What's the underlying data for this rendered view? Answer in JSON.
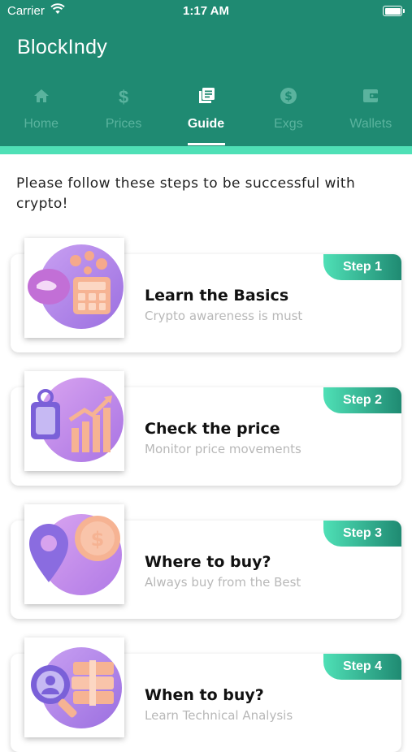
{
  "status_bar": {
    "carrier": "Carrier",
    "time": "1:17 AM"
  },
  "header": {
    "title": "BlockIndy"
  },
  "tabs": [
    {
      "label": "Home",
      "icon": "home-icon"
    },
    {
      "label": "Prices",
      "icon": "dollar-icon"
    },
    {
      "label": "Guide",
      "icon": "guide-book-icon",
      "active": true
    },
    {
      "label": "Exgs",
      "icon": "coin-icon"
    },
    {
      "label": "Wallets",
      "icon": "wallet-icon"
    }
  ],
  "intro": "Please follow these steps to be successful with crypto!",
  "steps": [
    {
      "badge": "Step 1",
      "title": "Learn the Basics",
      "subtitle": "Crypto awareness is must",
      "icon": "calculator-coins-icon"
    },
    {
      "badge": "Step 2",
      "title": "Check the price",
      "subtitle": "Monitor price movements",
      "icon": "price-tag-chart-icon"
    },
    {
      "badge": "Step 3",
      "title": "Where to buy?",
      "subtitle": "Always buy from the Best",
      "icon": "location-coin-icon"
    },
    {
      "badge": "Step 4",
      "title": "When to buy?",
      "subtitle": "Learn Technical Analysis",
      "icon": "magnifier-money-icon"
    }
  ],
  "colors": {
    "primary": "#1f8a72",
    "accent": "#4fe0b6",
    "inactive_tab": "#5ab39e"
  }
}
